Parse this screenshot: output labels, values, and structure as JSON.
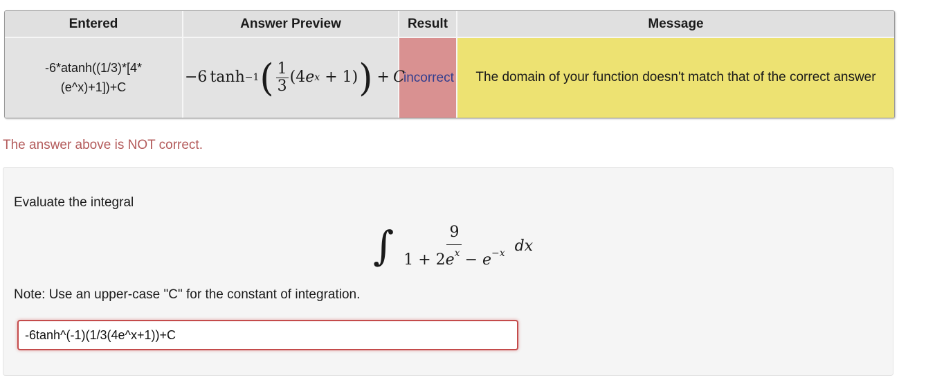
{
  "results_table": {
    "headers": [
      "Entered",
      "Answer Preview",
      "Result",
      "Message"
    ],
    "row": {
      "entered_line1": "-6*atanh((1/3)*[4*",
      "entered_line2": "(e^x)+1])+C",
      "preview": {
        "coef": "−6",
        "func": "tanh",
        "exponent": "−1",
        "frac_num": "1",
        "frac_den": "3",
        "inner_open": "(4",
        "inner_e": "e",
        "inner_exp": "x",
        "inner_rest": " + 1)",
        "plus": "+",
        "constant": "C"
      },
      "result": "incorrect",
      "message": "The domain of your function doesn't match that of the correct answer"
    },
    "colors": {
      "result_bg": "#d99191",
      "message_bg": "#ede272",
      "result_text": "#2f3d8f"
    }
  },
  "status_message": "The answer above is NOT correct.",
  "problem": {
    "instruction": "Evaluate the integral",
    "integral": {
      "sign": "∫",
      "numerator": "9",
      "denominator_a": "1 + 2",
      "denominator_e1": "e",
      "denominator_exp1": "x",
      "denominator_b": " − ",
      "denominator_e2": "e",
      "denominator_exp2": "−x",
      "differential": "dx"
    },
    "note": "Note: Use an upper-case \"C\" for the constant of integration.",
    "answer_value": "-6tanh^(-1)(1/3(4e^x+1))+C"
  }
}
